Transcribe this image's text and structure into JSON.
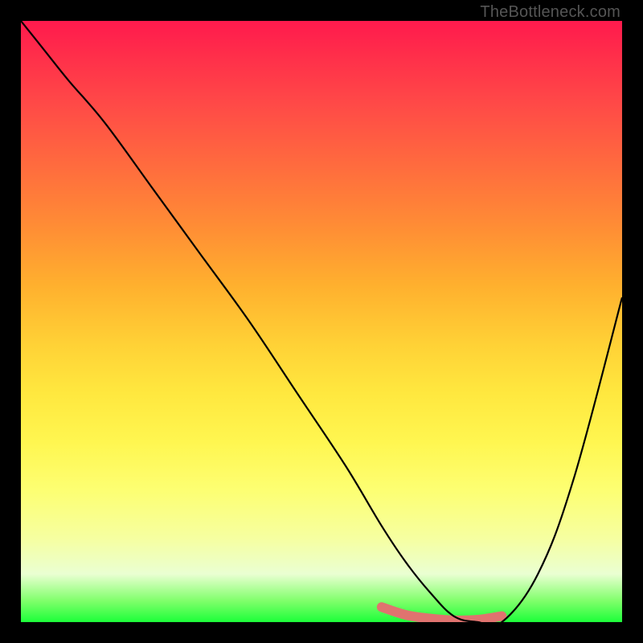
{
  "attribution": "TheBottleneck.com",
  "chart_data": {
    "type": "line",
    "title": "",
    "xlabel": "",
    "ylabel": "",
    "xlim": [
      0,
      100
    ],
    "ylim": [
      0,
      100
    ],
    "grid": false,
    "legend": false,
    "series": [
      {
        "name": "bottleneck-curve",
        "x": [
          0,
          4,
          8,
          14,
          22,
          30,
          38,
          46,
          54,
          60,
          64,
          68,
          72,
          76,
          80,
          86,
          92,
          100
        ],
        "y": [
          100,
          95,
          90,
          83,
          72,
          61,
          50,
          38,
          26,
          16,
          10,
          5,
          1,
          0,
          0,
          8,
          24,
          54
        ],
        "note": "y is percentage height from bottom (0) to top (100); estimated from pixels"
      },
      {
        "name": "optimal-band",
        "x": [
          60,
          64,
          68,
          72,
          76,
          80
        ],
        "y": [
          2.5,
          1.2,
          0.6,
          0.3,
          0.4,
          1.0
        ],
        "note": "thick salmon highlight near the curve minimum"
      }
    ],
    "colors": {
      "curve": "#000000",
      "optimal_band": "#e0736f",
      "gradient_top": "#ff1a4d",
      "gradient_bottom": "#1cff3a",
      "frame": "#000000"
    }
  }
}
